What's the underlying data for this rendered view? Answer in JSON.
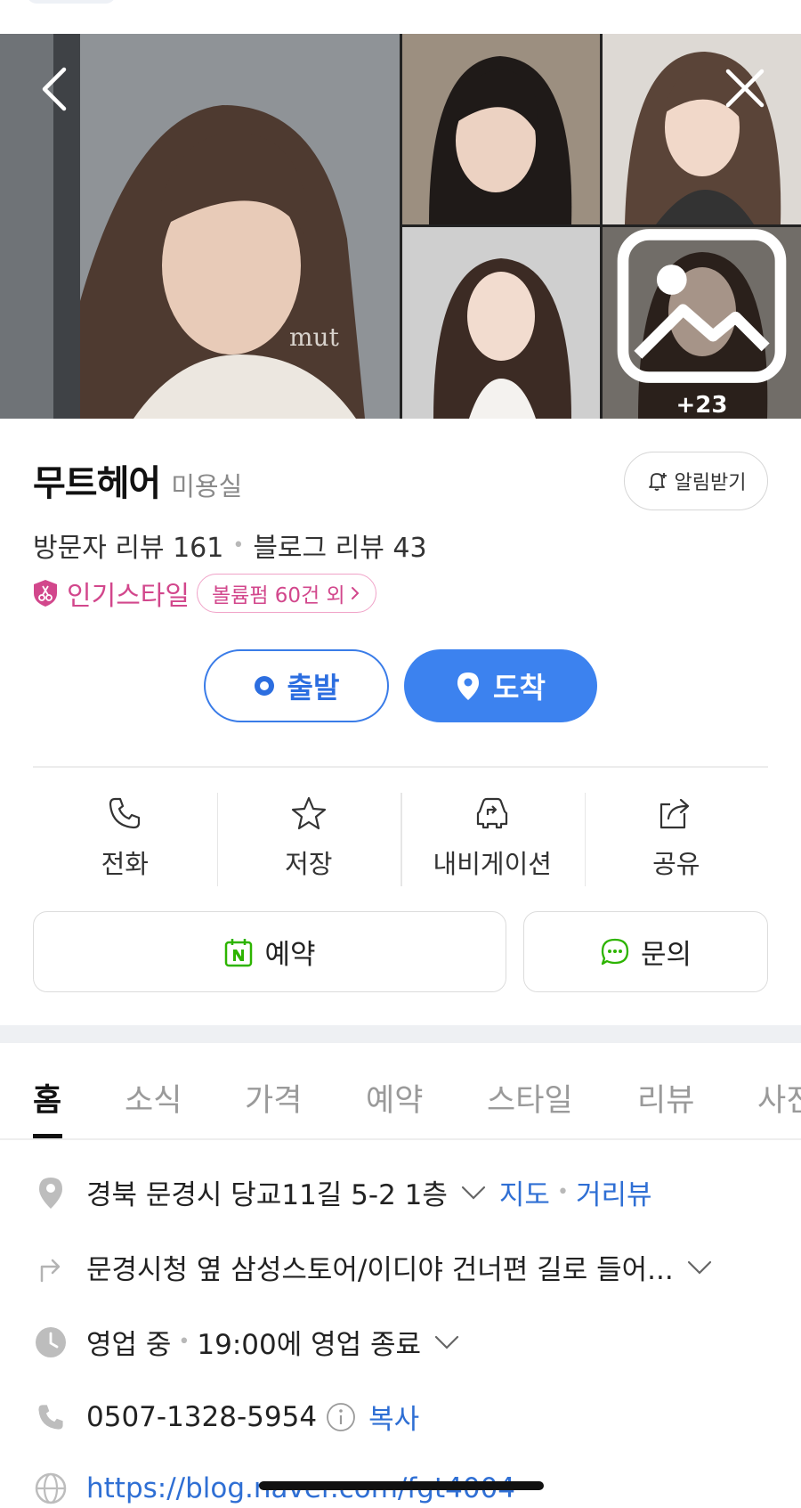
{
  "gallery": {
    "more_count": "+23",
    "watermark": "mut"
  },
  "place": {
    "name": "무트헤어",
    "category": "미용실",
    "alarm_label": "알림받기"
  },
  "reviews": {
    "visitor": "방문자 리뷰 161",
    "blog": "블로그 리뷰 43"
  },
  "popular_style": {
    "label": "인기스타일",
    "chip": "볼륨펌 60건 외"
  },
  "route": {
    "start_label": "출발",
    "end_label": "도착"
  },
  "actions": [
    {
      "label": "전화",
      "icon": "phone-icon"
    },
    {
      "label": "저장",
      "icon": "star-icon"
    },
    {
      "label": "내비게이션",
      "icon": "navigation-car-icon"
    },
    {
      "label": "공유",
      "icon": "share-icon"
    }
  ],
  "booking": {
    "book_label": "예약",
    "ask_label": "문의"
  },
  "tabs": [
    "홈",
    "소식",
    "가격",
    "예약",
    "스타일",
    "리뷰",
    "사진"
  ],
  "info": {
    "address": "경북 문경시 당교11길 5-2 1층",
    "map_link": "지도",
    "street_view_link": "거리뷰",
    "directions": "문경시청 옆 삼성스토어/이디야 건너편 길로 들어...",
    "status": "영업 중",
    "hours": "19:00에 영업 종료",
    "phone": "0507-1328-5954",
    "copy_label": "복사",
    "website": "https://blog.naver.com/fgt4004"
  },
  "colors": {
    "accent_blue": "#3c82ef",
    "link_blue": "#2f6fd4",
    "pink": "#d2478c",
    "naver_green": "#2db400"
  }
}
